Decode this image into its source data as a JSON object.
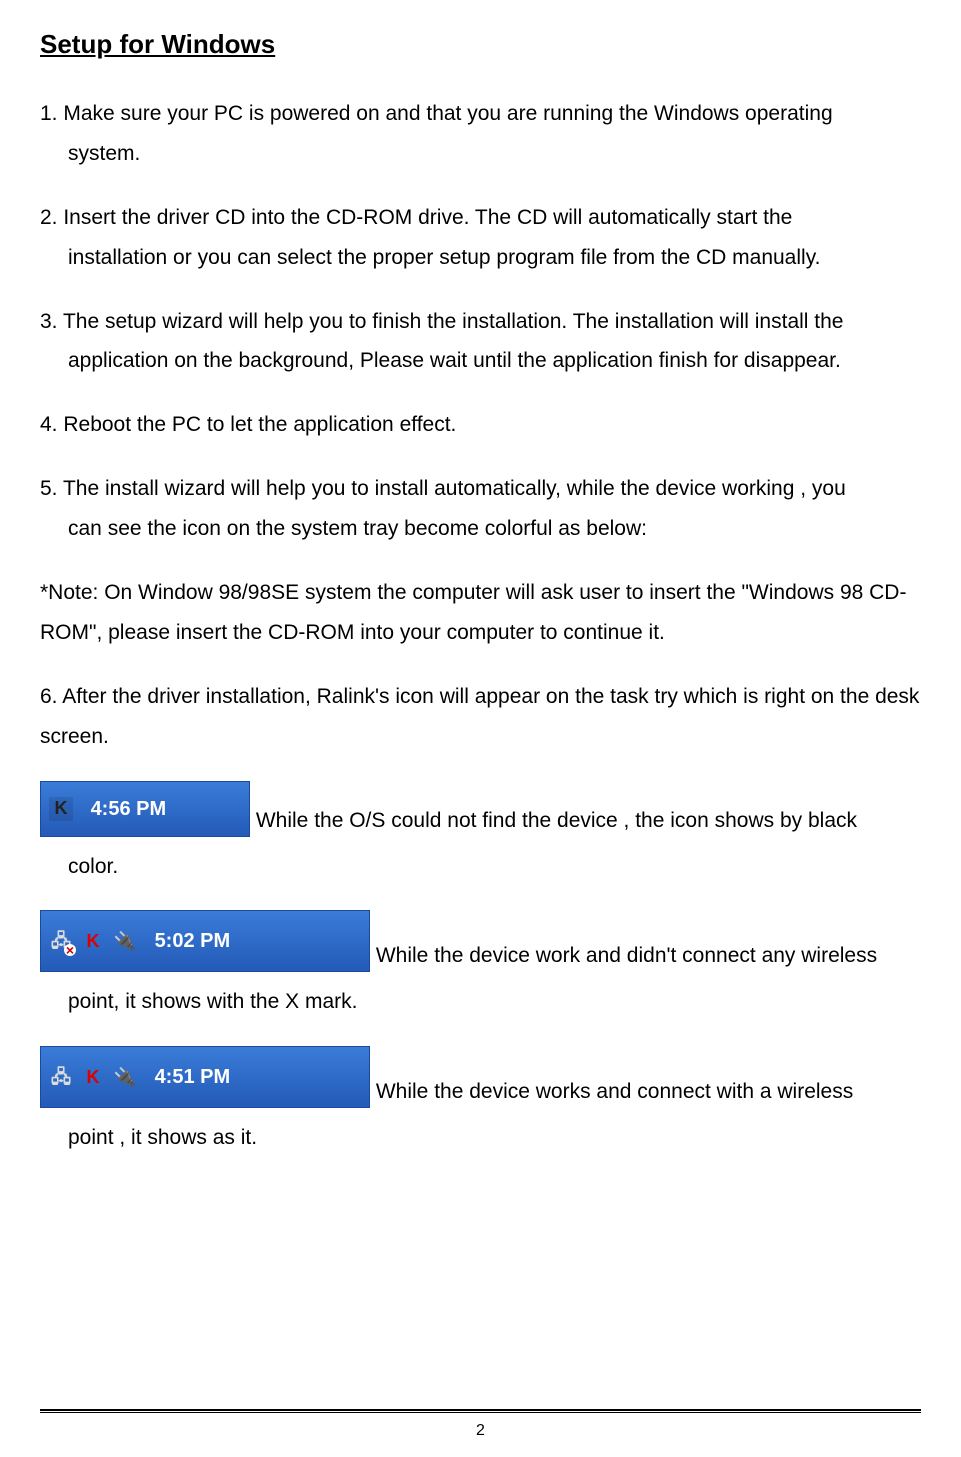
{
  "title": "Setup for Windows",
  "steps": {
    "s1_lead": "1. Make sure your PC is powered on and that you are running the Windows operating",
    "s1_cont": "system.",
    "s2_lead": "2. Insert the driver CD into the CD-ROM drive. The CD will automatically start the",
    "s2_cont": "installation or you can select the proper setup program file from the CD manually.",
    "s3_lead": "3. The setup wizard will help you to finish the installation. The installation will install the",
    "s3_cont": "application on the background, Please wait until the application finish for disappear.",
    "s4": "4. Reboot the PC to let the application effect.",
    "s5_lead": "5. The install wizard will help you to install automatically, while the device working , you",
    "s5_cont": "can see the icon on the system tray become colorful as below:",
    "note": "*Note: On Window 98/98SE system the computer will ask user to insert the \"Windows 98 CD-ROM\", please insert the CD-ROM into your computer to continue it.",
    "s6": "6. After the driver installation, Ralink's icon will appear on the task try which is right on the desk screen."
  },
  "tray": {
    "t1_time": "4:56 PM",
    "t1_k": "K",
    "t1_cap_after": " While the O/S could not find the device , the icon shows by black",
    "t1_cap_cont": "color.",
    "t2_time": "5:02 PM",
    "t2_k": "K",
    "t2_cap_after": "While the device work and didn't connect any wireless",
    "t2_cap_cont": "point, it shows with the X mark.",
    "t3_time": "4:51 PM",
    "t3_k": "K",
    "t3_cap_after": "While the device works and connect with a wireless",
    "t3_cap_cont": "point , it shows as it."
  },
  "page_number": "2"
}
